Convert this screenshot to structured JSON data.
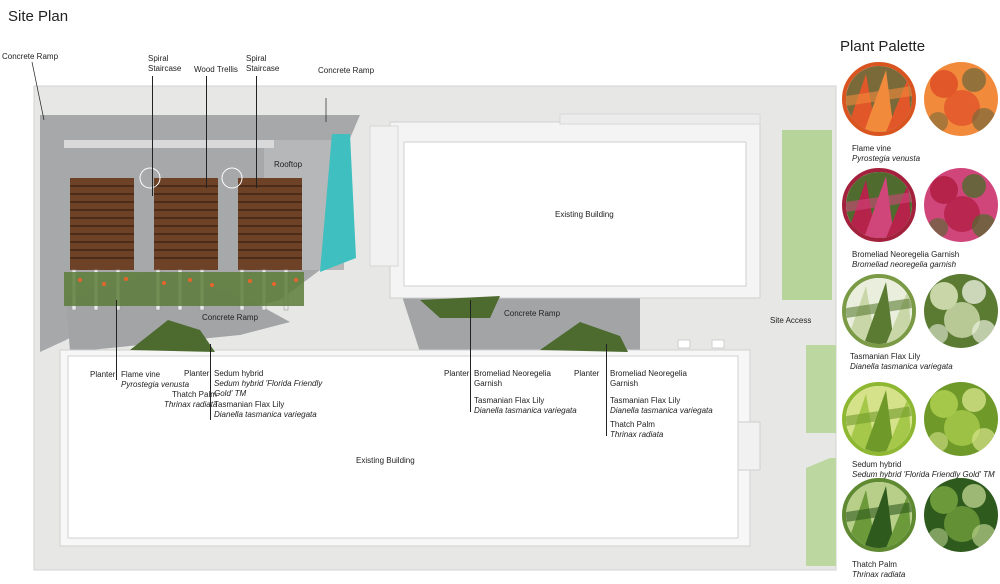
{
  "header": {
    "title": "Site Plan"
  },
  "palette": {
    "title": "Plant Palette",
    "plants": [
      {
        "name": "Flame vine",
        "scientific": "Pyrostegia venusta",
        "ring_color": "#d9541f",
        "fill_a": "#e2572a",
        "fill_b": "#f28a3c",
        "fill_c": "#7a6a3a"
      },
      {
        "name": "Bromeliad Neoregelia Garnish",
        "scientific": "Bromeliad neoregelia garnish",
        "ring_color": "#a3213c",
        "fill_a": "#b5224a",
        "fill_b": "#d0467a",
        "fill_c": "#4f6b2e"
      },
      {
        "name": "Tasmanian Flax Lily",
        "scientific": "Dianella tasmanica variegata",
        "ring_color": "#7a9a45",
        "fill_a": "#c9d7a8",
        "fill_b": "#5b7b33",
        "fill_c": "#e9efdc"
      },
      {
        "name": "Sedum hybrid",
        "scientific": "Sedum hybrid 'Florida Friendly Gold' TM",
        "ring_color": "#8fb832",
        "fill_a": "#a6c84a",
        "fill_b": "#6f9a2a",
        "fill_c": "#d5e28a"
      },
      {
        "name": "Thatch Palm",
        "scientific": "Thrinax radiata",
        "ring_color": "#5f8a32",
        "fill_a": "#6c9a3a",
        "fill_b": "#2f5a1e",
        "fill_c": "#b8cf8a"
      }
    ]
  },
  "plan_labels": {
    "concrete_ramp_left": "Concrete Ramp",
    "spiral_staircase_1": "Spiral\nStaircase",
    "wood_trellis": "Wood Trellis",
    "spiral_staircase_2": "Spiral\nStaircase",
    "concrete_ramp_top": "Concrete Ramp",
    "rooftop": "Rooftop",
    "existing_building_top": "Existing Building",
    "concrete_ramp_mid_left": "Concrete Ramp",
    "concrete_ramp_mid_right": "Concrete Ramp",
    "site_access": "Site Access",
    "existing_building_bottom": "Existing Building"
  },
  "callouts": {
    "c1_planter": "Planter",
    "c1_flame_vine": "Flame vine",
    "c1_flame_vine_sci": "Pyrostegia venusta",
    "c2_planter": "Planter",
    "c2_thatch": "Thatch Palm",
    "c2_thatch_sci": "Thrinax radiata",
    "c2_sedum": "Sedum hybrid",
    "c2_sedum_sci_1": "Sedum hybrid 'Florida Friendly",
    "c2_sedum_sci_2": "Gold' TM",
    "c2_flax": "Tasmanian Flax Lily",
    "c2_flax_sci": "Dianella tasmanica variegata",
    "c3_planter": "Planter",
    "c3_brom_1": "Bromeliad Neoregelia",
    "c3_brom_2": "Garnish",
    "c3_flax": "Tasmanian Flax Lily",
    "c3_flax_sci": "Dianella tasmanica variegata",
    "c4_planter": "Planter",
    "c4_brom_1": "Bromeliad Neoregelia",
    "c4_brom_2": "Garnish",
    "c4_flax": "Tasmanian Flax Lily",
    "c4_flax_sci": "Dianella tasmanica variegata",
    "c4_thatch": "Thatch Palm",
    "c4_thatch_sci": "Thrinax radiata"
  },
  "colors": {
    "site_bg": "#e7e8e6",
    "concrete": "#a9abac",
    "concrete_dark": "#8f9192",
    "building": "#ffffff",
    "wood": "#7a4a2c",
    "wood_dark": "#4e2d18",
    "glass": "#3fbfbf",
    "lawn": "#b7d49a",
    "planting": "#5c7d3a"
  }
}
